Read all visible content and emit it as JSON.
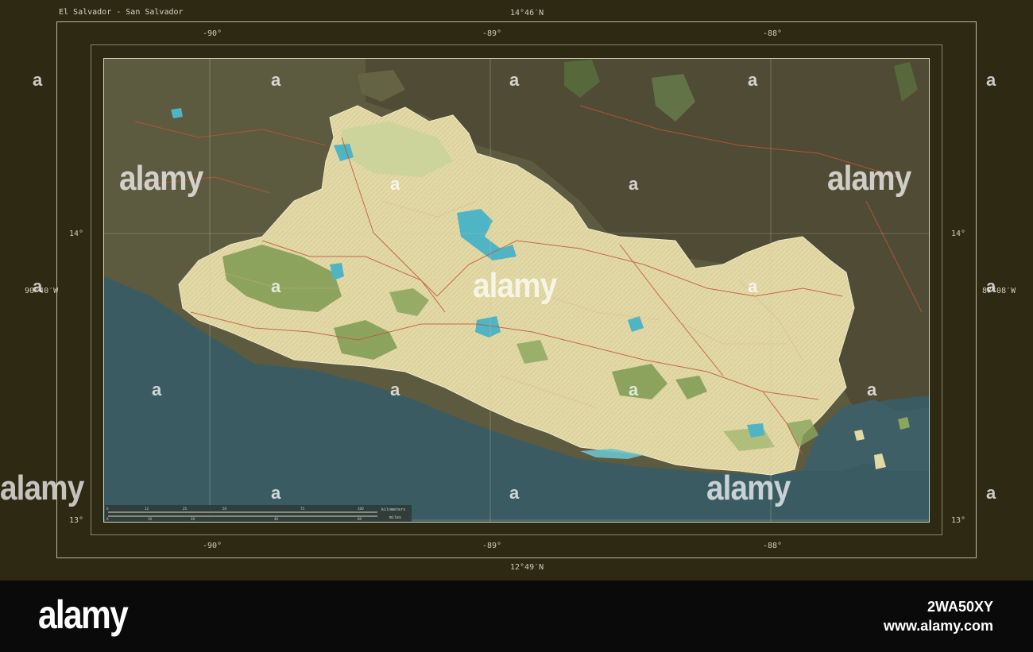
{
  "map": {
    "title": "El Salvador - San Salvador",
    "top_latitude": "14°46′N",
    "bottom_latitude": "12°49′N",
    "left_longitude": "90°40′W",
    "right_longitude": "87°08′W",
    "lon_ticks_top": [
      "-90°",
      "-89°",
      "-88°"
    ],
    "lon_ticks_bottom": [
      "-90°",
      "-89°",
      "-88°"
    ],
    "lat_ticks_left": [
      "14°",
      "13°"
    ],
    "lat_ticks_right": [
      "14°",
      "13°"
    ],
    "scale_bar": {
      "km_label": "kilometers",
      "miles_label": "miles",
      "km_ticks": [
        "0",
        "12",
        "25",
        "50",
        "75",
        "100"
      ],
      "mi_ticks": [
        "0",
        "10",
        "20",
        "40",
        "60"
      ]
    }
  },
  "colors": {
    "ocean": "#3b5b63",
    "foreign_land": "#5c5a3f",
    "country_land": "#e2d9a5",
    "forest": "#7e9a52",
    "lake": "#4fb4c4",
    "frame_bg": "#2d2913"
  },
  "watermark": {
    "small_glyph": "a",
    "word": "alamy"
  },
  "footer": {
    "brand": "alamy",
    "image_id": "2WA50XY",
    "site": "www.alamy.com"
  }
}
